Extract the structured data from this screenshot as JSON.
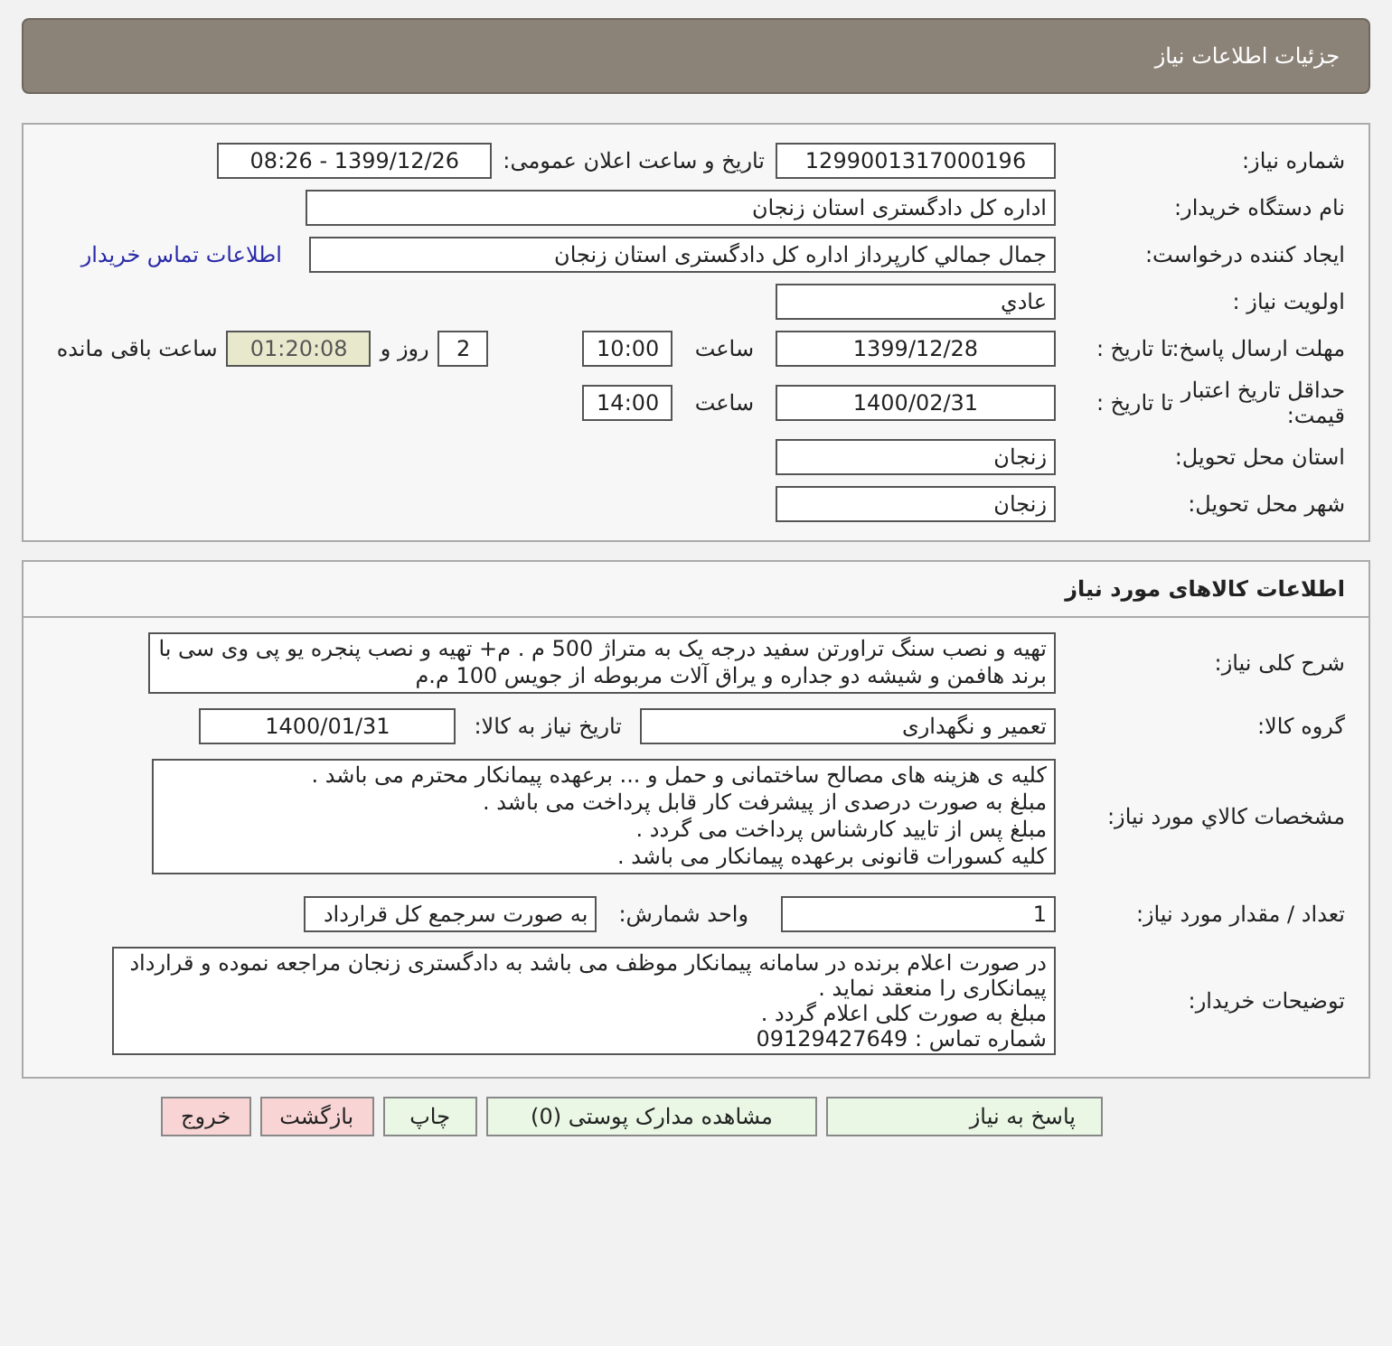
{
  "header": {
    "title": "جزئیات اطلاعات نیاز"
  },
  "need": {
    "number_label": "شماره نیاز:",
    "number": "1299001317000196",
    "announce_label": "تاریخ و ساعت اعلان عمومی:",
    "announce": "1399/12/26 - 08:26",
    "buyer_label": "نام دستگاه خریدار:",
    "buyer": "اداره کل دادگستری استان زنجان",
    "creator_label": "ایجاد کننده درخواست:",
    "creator": "جمال جمالي كارپرداز اداره کل دادگستری استان زنجان",
    "contact_link": "اطلاعات تماس خریدار",
    "priority_label": "اولویت نیاز :",
    "priority": "عادي",
    "deadline_label": "مهلت ارسال پاسخ:",
    "deadline_to": "تا تاریخ :",
    "deadline_date": "1399/12/28",
    "deadline_time_label": "ساعت",
    "deadline_time": "10:00",
    "days": "2",
    "days_label": "روز و",
    "remaining": "01:20:08",
    "remaining_label": "ساعت باقی مانده",
    "validity_label": "حداقل تاريخ اعتبار قیمت:",
    "validity_to": "تا تاریخ :",
    "validity_date": "1400/02/31",
    "validity_time_label": "ساعت",
    "validity_time": "14:00",
    "province_label": "استان محل تحویل:",
    "province": "زنجان",
    "city_label": "شهر محل تحویل:",
    "city": "زنجان"
  },
  "goods": {
    "title": "اطلاعات کالاهای مورد نیاز",
    "summary_label": "شرح کلی نیاز:",
    "summary": "تهیه و نصب سنگ تراورتن سفید درجه یک  به متراژ 500 م . م+ تهیه و نصب پنجره یو پی وی سی با برند هافمن و شیشه دو جداره و یراق آلات مربوطه از جویس 100 م.م",
    "group_label": "گروه کالا:",
    "group": "تعمیر و نگهداری",
    "need_date_label": "تاریخ نیاز به کالا:",
    "need_date": "1400/01/31",
    "specs_label": "مشخصات کالاي مورد نیاز:",
    "specs": [
      "کلیه ی هزینه های مصالح ساختمانی و حمل و ... برعهده پیمانکار محترم می باشد .",
      "مبلغ به صورت درصدی از پیشرفت کار قابل پرداخت می باشد .",
      "مبلغ پس از تایید کارشناس پرداخت می گردد .",
      "کلیه کسورات قانونی برعهده پیمانکار می باشد ."
    ],
    "qty_label": "تعداد / مقدار مورد نیاز:",
    "qty": "1",
    "unit_label": "واحد شمارش:",
    "unit": "به صورت سرجمع کل قرارداد",
    "notes_label": "توضیحات خریدار:",
    "notes": [
      "در صورت اعلام برنده در سامانه پیمانکار موظف می باشد به دادگستری زنجان مراجعه نموده و قرارداد پیمانکاری را منعقد نماید .",
      "مبلغ به صورت کلی اعلام گردد .",
      "شماره تماس : 09129427649"
    ]
  },
  "buttons": [
    {
      "label": "پاسخ به نیاز",
      "kind": "primary"
    },
    {
      "label": "مشاهده مدارک پوستی (0)",
      "kind": "primary"
    },
    {
      "label": "چاپ",
      "kind": "primary"
    },
    {
      "label": "بازگشت",
      "kind": "danger"
    },
    {
      "label": "خروج",
      "kind": "danger"
    }
  ]
}
